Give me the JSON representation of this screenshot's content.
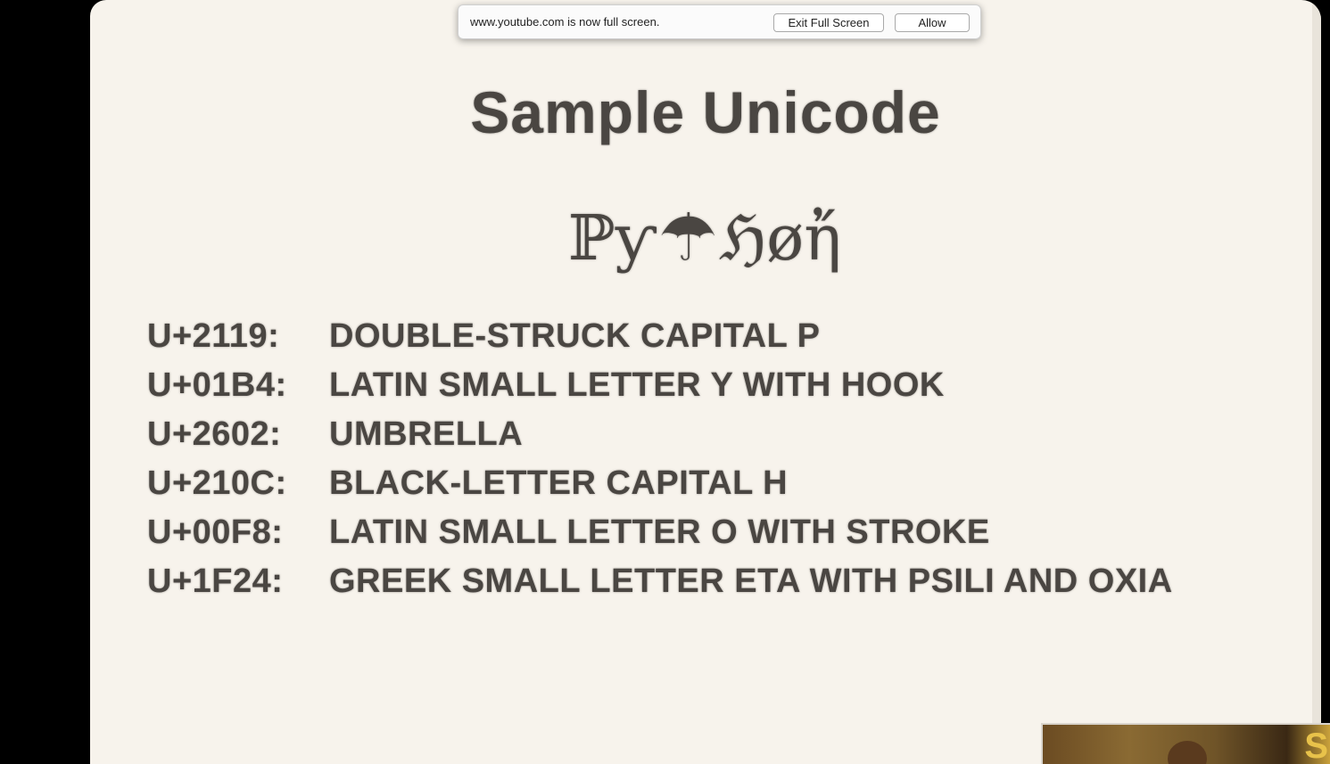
{
  "fullscreen_alert": {
    "message": "www.youtube.com is now full screen.",
    "exit_label": "Exit Full Screen",
    "allow_label": "Allow"
  },
  "slide": {
    "title": "Sample Unicode",
    "logo": {
      "parts": [
        "ℙƴ",
        "☂",
        "ℌøἤ"
      ]
    },
    "entries": [
      {
        "code": "U+2119:",
        "name": "DOUBLE-STRUCK CAPITAL P"
      },
      {
        "code": "U+01B4:",
        "name": "LATIN SMALL LETTER Y WITH HOOK"
      },
      {
        "code": "U+2602:",
        "name": "UMBRELLA"
      },
      {
        "code": "U+210C:",
        "name": "BLACK-LETTER CAPITAL H"
      },
      {
        "code": "U+00F8:",
        "name": "LATIN SMALL LETTER O WITH STROKE"
      },
      {
        "code": "U+1F24:",
        "name": "GREEK SMALL LETTER ETA WITH PSILI AND OXIA"
      }
    ]
  },
  "speaker_video": {
    "corner_letter": "S"
  },
  "colors": {
    "slide_background": "#f7f3ec",
    "slide_text": "#4a4642",
    "page_background": "#000000"
  }
}
